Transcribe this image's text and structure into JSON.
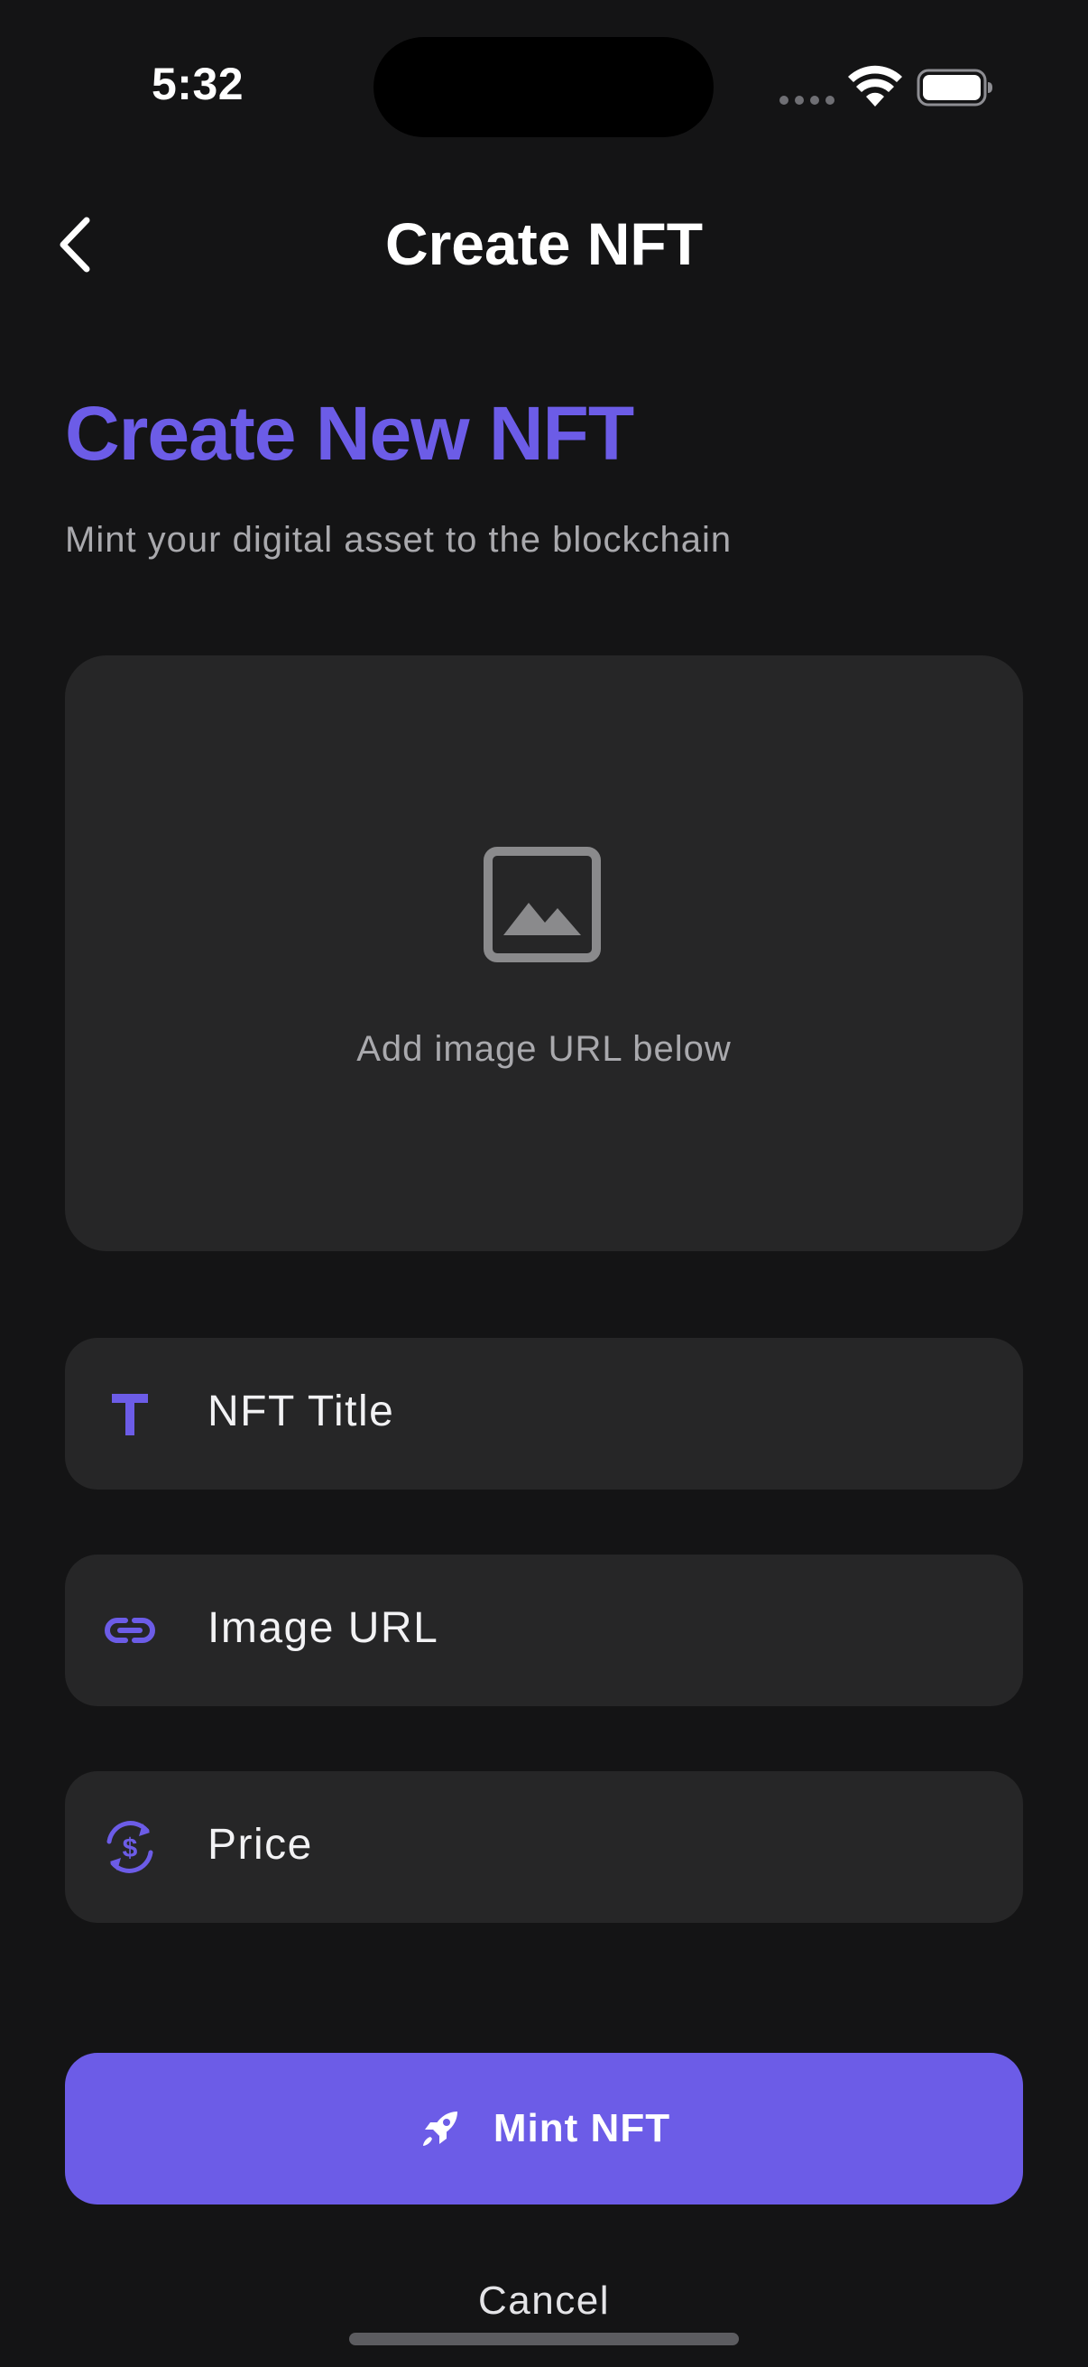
{
  "status_bar": {
    "time": "5:32"
  },
  "nav": {
    "title": "Create NFT"
  },
  "header": {
    "heading": "Create New NFT",
    "subtitle": "Mint your digital asset to the blockchain"
  },
  "preview": {
    "hint": "Add image URL below",
    "icon": "image-icon"
  },
  "form": {
    "title_placeholder": "NFT Title",
    "image_url_placeholder": "Image URL",
    "price_placeholder": "Price",
    "title_icon": "text-T-icon",
    "image_url_icon": "link-icon",
    "price_icon": "currency-exchange-icon"
  },
  "actions": {
    "mint_label": "Mint NFT",
    "cancel_label": "Cancel",
    "mint_icon": "rocket-icon"
  },
  "colors": {
    "accent": "#6c5ce7",
    "background": "#141415",
    "surface": "#262627",
    "muted_text": "#a9a9ad"
  }
}
